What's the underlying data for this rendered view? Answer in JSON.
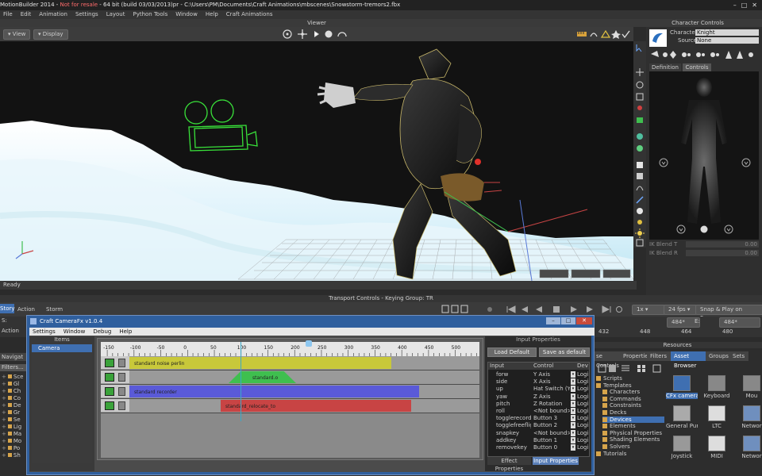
{
  "app": {
    "title_prefix": "MotionBuilder 2014 - ",
    "title_warning": "Not for resale",
    "title_rest": " - 64 bit (build 03/03/2013)pr  - C:\\Users\\PM\\Documents\\Craft Animations\\mbscenes\\Snowstorm-tremors2.fbx"
  },
  "menu": [
    "File",
    "Edit",
    "Animation",
    "Settings",
    "Layout",
    "Python Tools",
    "Window",
    "Help",
    "Craft Animations"
  ],
  "viewer": {
    "header": "Viewer",
    "view_btn": "View",
    "display_btn": "Display",
    "status": "Ready"
  },
  "character_controls": {
    "header": "Character Controls",
    "character_label": "Character:",
    "character_value": "Knight",
    "source_label": "Source:",
    "source_value": "None",
    "tab_definition": "Definition",
    "tab_controls": "Controls",
    "ik_blend_t": "IK Blend T",
    "ik_blend_r": "IK Blend R",
    "blend_values": [
      "0.00",
      "0.00"
    ]
  },
  "transport": {
    "header": "Transport Controls  -  Keying Group: TR",
    "story_tab": "Story",
    "action_label": "Action",
    "storm_label": "Storm",
    "speed": "1x",
    "fps": "24 fps",
    "snap": "Snap & Play on Frames",
    "frames_start": "484*",
    "frames_end": "484*",
    "e_label": "E:",
    "s_label": "S:",
    "ruler": [
      "432",
      "448",
      "464",
      "480"
    ],
    "action_row_label": "Action"
  },
  "cfx": {
    "title": "Craft CameraFx v1.0.4",
    "menu": [
      "Settings",
      "Window",
      "Debug",
      "Help"
    ],
    "items_header": "Items",
    "items": [
      "Camera"
    ],
    "ruler": [
      "-150",
      "-100",
      "-50",
      "0",
      "50",
      "100",
      "150",
      "200",
      "250",
      "300",
      "350",
      "400",
      "450",
      "500"
    ],
    "tracks": [
      {
        "label": "standard noise perlin",
        "color": "#c8c83a"
      },
      {
        "label": "standard.o",
        "color": "#3fbf4f"
      },
      {
        "label": "standard recorder",
        "color": "#5a5ad8"
      },
      {
        "label": "standard_relocate_to",
        "color": "#c84444"
      }
    ],
    "input_props_header": "Input Properties",
    "load_default": "Load Default",
    "save_default": "Save as default",
    "col_input": "Input",
    "col_control": "Control",
    "col_dev": "Dev",
    "rows": [
      [
        "forw",
        "Y Axis",
        "Logi"
      ],
      [
        "side",
        "X Axis",
        "Logi"
      ],
      [
        "up",
        "Hat Switch (Y ax",
        "Logi"
      ],
      [
        "yaw",
        "Z Axis",
        "Logi"
      ],
      [
        "pitch",
        "Z Rotation",
        "Logi"
      ],
      [
        "roll",
        "<Not bound>",
        "Logi"
      ],
      [
        "togglerecord",
        "Button 3",
        "Logi"
      ],
      [
        "togglefreeflight",
        "Button 2",
        "Logi"
      ],
      [
        "snapkey",
        "<Not bound>",
        "Logi"
      ],
      [
        "addkey",
        "Button 1",
        "Logi"
      ],
      [
        "removekey",
        "Button 0",
        "Logi"
      ]
    ],
    "tab_effect": "Effect Properties",
    "tab_input": "Input Properties"
  },
  "left_nav": {
    "navigator_tab": "Navigat",
    "filters": "Filters...",
    "items": [
      "Sce",
      "Gl",
      "Ch",
      "Co",
      "De",
      "Gr",
      "Se",
      "Lig",
      "Ma",
      "Mo",
      "Po",
      "Sh"
    ]
  },
  "resources": {
    "header": "Resources",
    "tabs": [
      "se Controls",
      "Properties",
      "Filters",
      "Asset Browser",
      "Groups",
      "Sets"
    ],
    "tree": [
      "Scripts",
      "Templates",
      "Characters",
      "Commands",
      "Constraints",
      "Decks",
      "Devices",
      "Elements",
      "Physical Properties",
      "Shading Elements",
      "Solvers",
      "Tutorials"
    ],
    "assets": [
      "CFx camera",
      "Keyboard",
      "Mou",
      "General Purp...",
      "LTC",
      "Networ",
      "Joystick",
      "MIDI",
      "Networ"
    ]
  },
  "colors": {
    "accent": "#3f6fb1",
    "cfx_frame": "#2f5f9e",
    "track_yellow": "#c8c83a",
    "track_green": "#3fbf4f",
    "track_blue": "#5a5ad8",
    "track_red": "#c84444"
  }
}
